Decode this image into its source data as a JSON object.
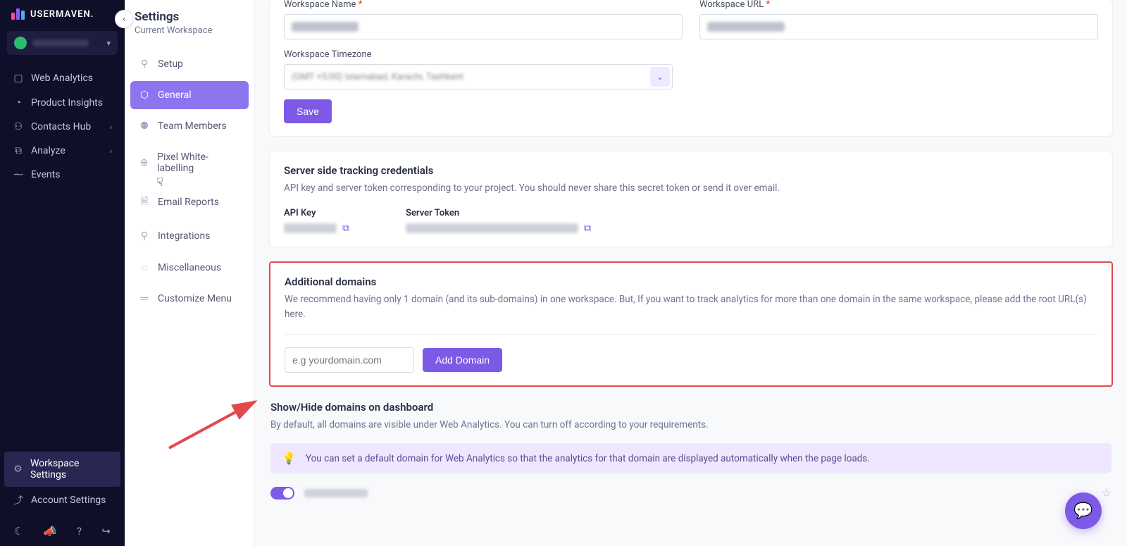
{
  "brand": "USERMAVEN.",
  "nav": {
    "items": [
      {
        "label": "Web Analytics",
        "icon": "▢"
      },
      {
        "label": "Product Insights",
        "icon": "◔"
      },
      {
        "label": "Contacts Hub",
        "icon": "⚇",
        "chev": true
      },
      {
        "label": "Analyze",
        "icon": "⧉",
        "chev": true
      },
      {
        "label": "Events",
        "icon": "⁓"
      }
    ],
    "bottom": [
      {
        "label": "Workspace Settings",
        "icon": "⚙",
        "active": true
      },
      {
        "label": "Account Settings",
        "icon": "⤴"
      }
    ]
  },
  "settings": {
    "title": "Settings",
    "subtitle": "Current Workspace",
    "items": [
      {
        "label": "Setup",
        "icon": "⚲"
      },
      {
        "label": "General",
        "icon": "⬡",
        "active": true
      },
      {
        "label": "Team Members",
        "icon": "⚉"
      },
      {
        "label": "Pixel White-labelling",
        "icon": "⊕"
      },
      {
        "label": "Email Reports",
        "icon": "🗎"
      },
      {
        "label": "Integrations",
        "icon": "⚲"
      },
      {
        "label": "Miscellaneous",
        "icon": "◌"
      },
      {
        "label": "Customize Menu",
        "icon": "≔"
      }
    ]
  },
  "workspace": {
    "name_label": "Workspace Name",
    "url_label": "Workspace URL",
    "tz_label": "Workspace Timezone",
    "tz_value": "(GMT +5:00) Islamabad, Karachi, Tashkent",
    "save": "Save"
  },
  "server": {
    "title": "Server side tracking credentials",
    "desc": "API key and server token corresponding to your project. You should never share this secret token or send it over email.",
    "api_label": "API Key",
    "token_label": "Server Token"
  },
  "domains": {
    "title": "Additional domains",
    "desc": "We recommend having only 1 domain (and its sub-domains) in one workspace. But, If you want to track analytics for more than one domain in the same workspace, please add the root URL(s) here.",
    "placeholder": "e.g yourdomain.com",
    "add": "Add Domain"
  },
  "show_hide": {
    "title": "Show/Hide domains on dashboard",
    "desc": "By default, all domains are visible under Web Analytics. You can turn off according to your requirements.",
    "banner": "You can set a default domain for Web Analytics so that the analytics for that domain are displayed automatically when the page loads."
  },
  "colors": {
    "primary": "#7d5ae6",
    "highlight": "#e4484d"
  }
}
